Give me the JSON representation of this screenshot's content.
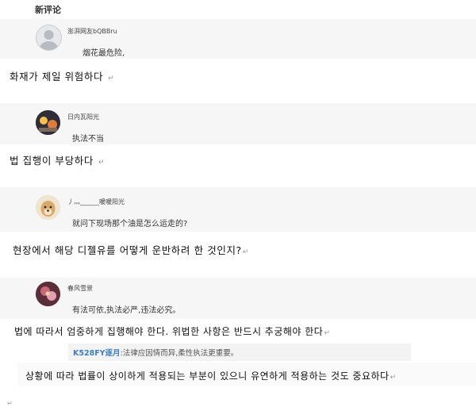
{
  "header": {
    "title": "新评论"
  },
  "comments": [
    {
      "avatar_icon": "default-avatar-icon",
      "username": "澎湃网友bQBBru",
      "text": "烟花最危险,",
      "translation": "화재가 제일 위험하다"
    },
    {
      "avatar_icon": "sunset-avatar-icon",
      "username": "日内瓦阳光",
      "text": "执法不当",
      "translation": "법 집행이 부당하다"
    },
    {
      "avatar_icon": "dog-avatar-icon",
      "username": "丿灬______暖暖阳光",
      "text": "就问下现场那个油是怎么运走的?",
      "translation": "현장에서 해당 디젤유를 어떻게 운반하려 한 것인지?"
    },
    {
      "avatar_icon": "flower-avatar-icon",
      "username": "春风雪景",
      "text": "有法可依,执法必严,违法必究。",
      "translation": "법에 따라서 엄중하게 집행해야 한다. 위법한 사항은 반드시 추궁해야 한다"
    }
  ],
  "reply": {
    "username": "K528FY逐月",
    "separator": ":",
    "text": "法律应因情而异,柔性执法更重要。",
    "translation": "상황에 따라 법률이 상이하게 적용되는 부분이 있으니 유연하게 적용하는 것도 중요하다"
  },
  "return_mark": "↵",
  "colors": {
    "band": "#f6f6f6",
    "reply_name": "#3f7fbf"
  }
}
